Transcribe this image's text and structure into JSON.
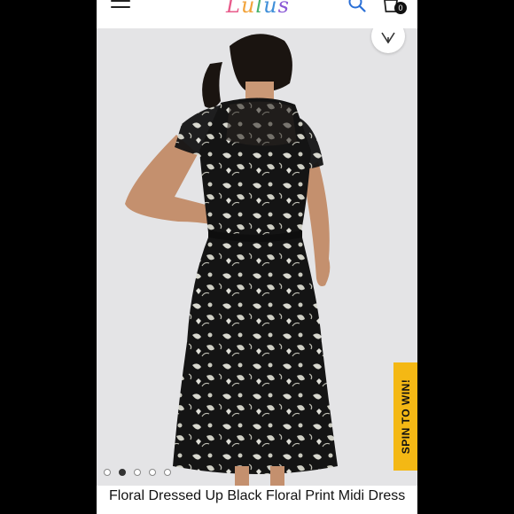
{
  "header": {
    "logo_text": "Lulus",
    "cart_count": "0",
    "icons": {
      "menu": "hamburger-menu-icon",
      "search": "search-icon",
      "cart": "shopping-bag-icon"
    }
  },
  "gallery": {
    "image_description": "Back view of model wearing black floral print midi dress",
    "slide_count": 5,
    "active_slide": 2,
    "wishlist_icon": "heart-icon"
  },
  "promo": {
    "label": "SPIN TO WIN!",
    "color": "#F4B814"
  },
  "product": {
    "title": "Floral Dressed Up Black Floral Print Midi Dress"
  }
}
